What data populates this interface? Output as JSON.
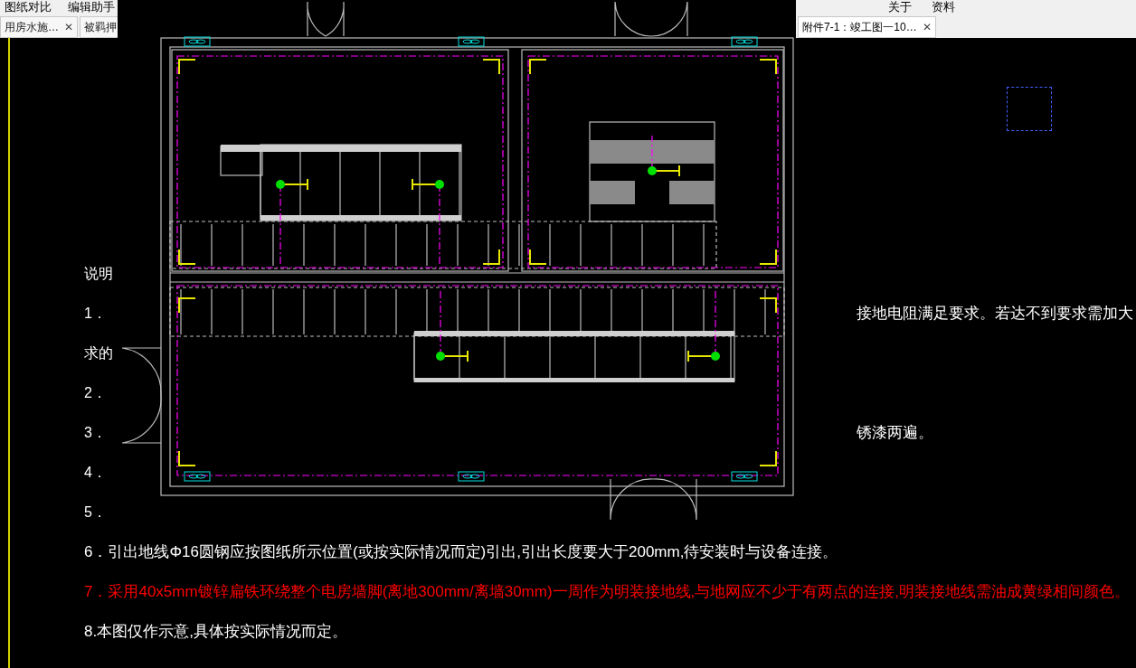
{
  "menu_left": [
    {
      "label": "图纸对比"
    },
    {
      "label": "编辑助手"
    }
  ],
  "menu_right": [
    {
      "label": "关于"
    },
    {
      "label": "资料"
    }
  ],
  "tabs": [
    {
      "label": "用房水施…",
      "selected": false,
      "close": "✕"
    },
    {
      "label": "被羁押",
      "selected": false
    },
    {
      "label": "附件7-1：竣工图一10…",
      "selected": true,
      "close": "✕"
    }
  ],
  "notes": [
    {
      "left": "说明",
      "color": "#ffffff"
    },
    {
      "left": "1．",
      "right": "接地电阻满足要求。若达不到要求需加大",
      "color": "#ffffff"
    },
    {
      "left": "求的",
      "color": "#ffffff"
    },
    {
      "left": "2．",
      "color": "#ffffff"
    },
    {
      "left": "3．",
      "right": "锈漆两遍。",
      "color": "#ffffff"
    },
    {
      "left": "4．",
      "color": "#ffffff"
    },
    {
      "left": "5．",
      "color": "#ffffff"
    },
    {
      "left": "6．引出地线Φ16圆钢应按图纸所示位置(或按实际情况而定)引出,引出长度要大于200mm,待安装时与设备连接。",
      "color": "#ffffff"
    },
    {
      "left": "7．采用40x5mm镀锌扁铁环绕整个电房墙脚(离地300mm/离墙30mm)一周作为明装接地线,与地网应不少于有两点的连接,明装接地线需油成黄绿相间颜色。",
      "color": "#ff0000"
    },
    {
      "left": "8.本图仅作示意,具体按实际情况而定。",
      "color": "#ffffff"
    }
  ]
}
